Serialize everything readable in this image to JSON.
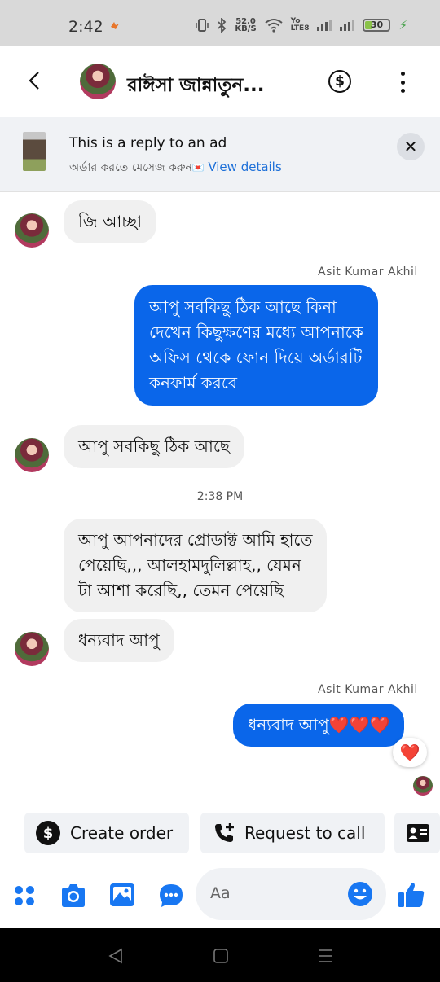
{
  "status_bar": {
    "time": "2:42",
    "speed_value": "52.0",
    "speed_unit": "KB/S",
    "network_label_1": "Yo",
    "network_label_2": "LTE8",
    "battery": "30"
  },
  "header": {
    "contact_name": "রাঈসা জান্নাতুন...",
    "back_icon": "back-arrow-icon",
    "payment_icon": "dollar-icon",
    "menu_icon": "more-vertical-icon"
  },
  "ad_banner": {
    "line1": "This is a reply to an ad",
    "line2_text": "অর্ডার করতে মেসেজ করুন",
    "heart": "💌",
    "link": "View details"
  },
  "messages": [
    {
      "direction": "in",
      "text": "জি আচ্ছা"
    },
    {
      "direction": "out",
      "sender": "Asit Kumar Akhil",
      "lines": [
        "আপু সবকিছু ঠিক আছে কিনা",
        "দেখেন কিছুক্ষণের  মধ্যে আপনাকে",
        "অফিস থেকে ফোন দিয়ে অর্ডারটি",
        "কনফার্ম করবে"
      ]
    },
    {
      "direction": "in",
      "text": "আপু সবকিছু ঠিক আছে"
    },
    {
      "timestamp": "2:38 PM"
    },
    {
      "direction": "in",
      "lines": [
        "আপু আপনাদের প্রোডাক্ট আমি হাতে",
        "পেয়েছি,,, আলহামদুলিল্লাহ,, যেমন",
        "টা আশা করেছি,, তেমন পেয়েছি"
      ]
    },
    {
      "direction": "in",
      "text": "ধন্যবাদ আপু"
    },
    {
      "direction": "out",
      "sender": "Asit Kumar Akhil",
      "text": "ধন্যবাদ আপু❤️❤️❤️",
      "reaction": "❤️"
    }
  ],
  "quick_actions": {
    "create_order": "Create order",
    "request_call": "Request to call"
  },
  "composer": {
    "placeholder": "Aa"
  },
  "colors": {
    "accent": "#0a66ea",
    "incoming_bubble": "#f0f0f0",
    "heart": "#e8223a"
  }
}
